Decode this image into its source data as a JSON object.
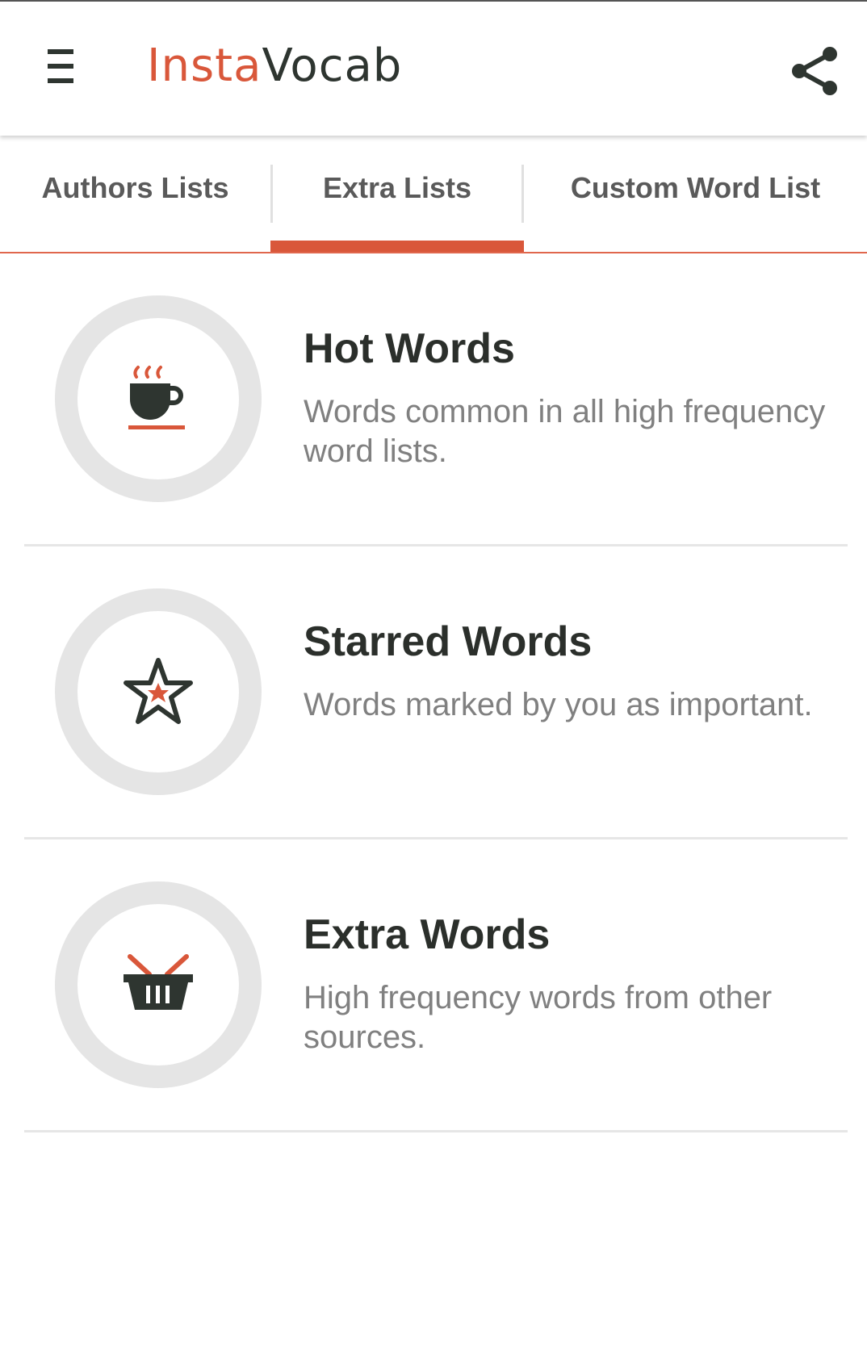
{
  "colors": {
    "accent": "#d9573a",
    "dark": "#2e3530",
    "muted_text": "#808080",
    "ring": "#e5e5e5"
  },
  "app_bar": {
    "title_part1": "Insta",
    "title_part2": "Vocab",
    "menu_icon": "hamburger-menu-icon",
    "share_icon": "share-icon"
  },
  "tabs": [
    {
      "label": "Authors Lists",
      "selected": false
    },
    {
      "label": "Extra Lists",
      "selected": true
    },
    {
      "label": "Custom Word List",
      "selected": false
    }
  ],
  "lists": [
    {
      "title": "Hot Words",
      "description": "Words common in all high frequency word lists.",
      "icon": "hot-coffee-cup-icon"
    },
    {
      "title": "Starred Words",
      "description": "Words marked by you as important.",
      "icon": "star-icon"
    },
    {
      "title": "Extra Words",
      "description": "High frequency words from other sources.",
      "icon": "basket-icon"
    }
  ]
}
